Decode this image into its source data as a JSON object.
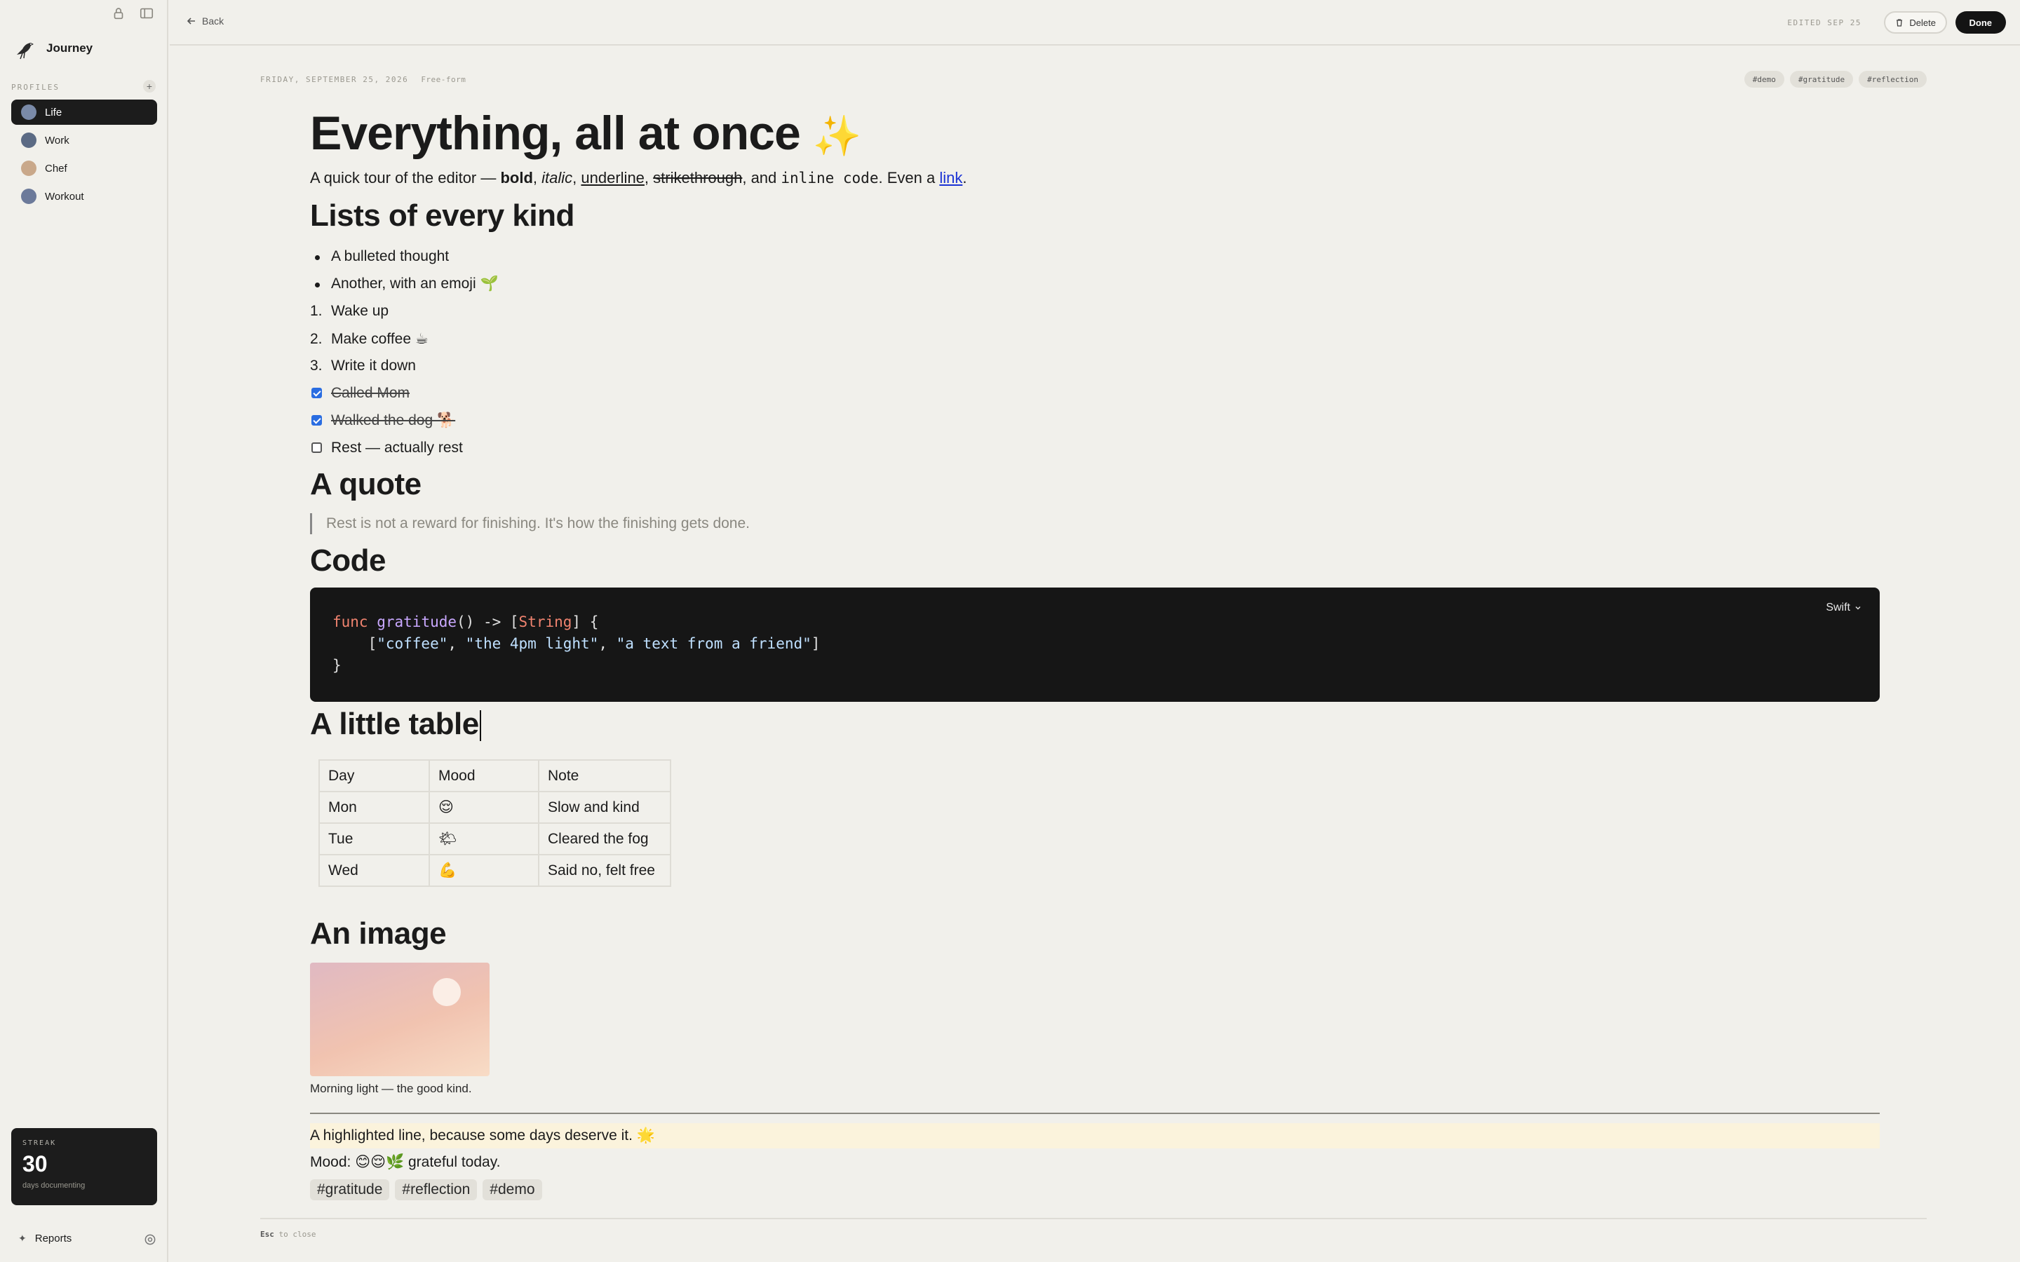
{
  "sidebar": {
    "app_name": "Journey",
    "profiles_label": "PROFILES",
    "profiles": [
      {
        "label": "Life",
        "active": true
      },
      {
        "label": "Work",
        "active": false
      },
      {
        "label": "Chef",
        "active": false
      },
      {
        "label": "Workout",
        "active": false
      }
    ],
    "streak": {
      "label": "STREAK",
      "value": "30",
      "sub": "days documenting"
    },
    "reports_label": "Reports"
  },
  "topbar": {
    "back_label": "Back",
    "edited": "EDITED SEP 25",
    "delete_label": "Delete",
    "done_label": "Done"
  },
  "doc": {
    "date": "FRIDAY, SEPTEMBER 25, 2026",
    "mode": "Free-form",
    "top_tags": [
      "#demo",
      "#gratitude",
      "#reflection"
    ],
    "title": "Everything, all at once",
    "title_emoji": "✨",
    "intro": {
      "lead": "A quick tour of the editor — ",
      "bold": "bold",
      "italic": "italic",
      "underline": "underline",
      "strike": "strikethrough",
      "and": ", and ",
      "code": "inline code",
      "even": ". Even a ",
      "link": "link",
      "end": "."
    },
    "h_lists": "Lists of every kind",
    "bullets": [
      "A bulleted thought",
      "Another, with an emoji 🌱"
    ],
    "numbered": [
      "Wake up",
      "Make coffee ☕",
      "Write it down"
    ],
    "numbered_markers": [
      "1.",
      "2.",
      "3."
    ],
    "todos": [
      {
        "label": "Called Mom",
        "checked": true
      },
      {
        "label": "Walked the dog 🐕",
        "checked": true
      },
      {
        "label": "Rest — actually rest",
        "checked": false
      }
    ],
    "h_quote": "A quote",
    "quote": "Rest is not a reward for finishing. It's how the finishing gets done.",
    "h_code": "Code",
    "code_lang": "Swift",
    "code": {
      "l1_kw": "func",
      "l1_fn": "gratitude",
      "l1_mid": "() -> [",
      "l1_ty": "String",
      "l1_end": "] {",
      "l2_open": "    [",
      "l2_s1": "\"coffee\"",
      "l2_c1": ", ",
      "l2_s2": "\"the 4pm light\"",
      "l2_c2": ", ",
      "l2_s3": "\"a text from a friend\"",
      "l2_close": "]",
      "l3": "}"
    },
    "h_table": "A little table",
    "table": {
      "header": [
        "Day",
        "Mood",
        "Note"
      ],
      "rows": [
        [
          "Mon",
          "😌",
          "Slow and kind"
        ],
        [
          "Tue",
          "🌤",
          "Cleared the fog"
        ],
        [
          "Wed",
          "💪",
          "Said no, felt free"
        ]
      ]
    },
    "h_image": "An image",
    "image_caption": "Morning light — the good kind.",
    "highlight": "A highlighted line, because some days deserve it. 🌟",
    "mood": "Mood: 😊😌🌿  grateful today.",
    "bottom_tags": [
      "#gratitude",
      "#reflection",
      "#demo"
    ],
    "esc_key": "Esc",
    "esc_text": " to close"
  }
}
